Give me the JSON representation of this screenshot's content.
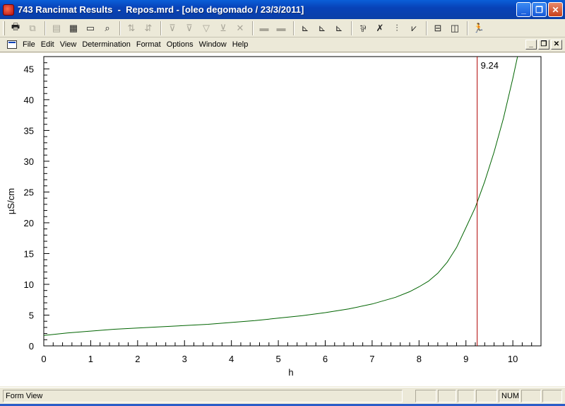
{
  "window": {
    "title": "743 Rancimat Results  -  Repos.mrd - [oleo degomado / 23/3/2011]",
    "controls": [
      "_",
      "❐",
      "✕"
    ]
  },
  "toolbar": {
    "groups": [
      [
        {
          "icon": "printer-icon",
          "glyph": "🖶",
          "enabled": true
        },
        {
          "icon": "copy-icon",
          "glyph": "⧉",
          "enabled": false
        }
      ],
      [
        {
          "icon": "form-view-icon",
          "glyph": "▤",
          "enabled": false
        },
        {
          "icon": "table-view-icon",
          "glyph": "▦",
          "enabled": true
        },
        {
          "icon": "card-view-icon",
          "glyph": "▭",
          "enabled": true
        },
        {
          "icon": "binoculars-icon",
          "glyph": "⌕",
          "enabled": true
        }
      ],
      [
        {
          "icon": "sort-ascending-icon",
          "glyph": "⇅",
          "enabled": false
        },
        {
          "icon": "sort-descending-icon",
          "glyph": "⇵",
          "enabled": false
        }
      ],
      [
        {
          "icon": "filter-icon",
          "glyph": "⊽",
          "enabled": false
        },
        {
          "icon": "filter-add-icon",
          "glyph": "⊽",
          "enabled": false
        },
        {
          "icon": "filter-clear-icon",
          "glyph": "▽",
          "enabled": false
        },
        {
          "icon": "filter-remove-icon",
          "glyph": "⊻",
          "enabled": false
        },
        {
          "icon": "delete-icon",
          "glyph": "✕",
          "enabled": false
        }
      ],
      [
        {
          "icon": "record-prev-icon",
          "glyph": "▬",
          "enabled": false
        },
        {
          "icon": "record-next-icon",
          "glyph": "▬",
          "enabled": false
        }
      ],
      [
        {
          "icon": "curve-red-icon",
          "glyph": "⊾",
          "enabled": true
        },
        {
          "icon": "curve-blue-icon",
          "glyph": "⊾",
          "enabled": true
        },
        {
          "icon": "curve-multi-icon",
          "glyph": "⊾",
          "enabled": true
        }
      ],
      [
        {
          "icon": "evaluate-icon",
          "glyph": "⅌",
          "enabled": true
        },
        {
          "icon": "cross-evaluate-icon",
          "glyph": "✗",
          "enabled": true
        },
        {
          "icon": "column-icon",
          "glyph": "⫶",
          "enabled": true
        },
        {
          "icon": "marker-icon",
          "glyph": "⩗",
          "enabled": true
        }
      ],
      [
        {
          "icon": "split-horizontal-icon",
          "glyph": "⊟",
          "enabled": true
        },
        {
          "icon": "split-vertical-icon",
          "glyph": "◫",
          "enabled": true
        }
      ],
      [
        {
          "icon": "runner-icon",
          "glyph": "🏃",
          "enabled": true
        }
      ]
    ]
  },
  "menu": {
    "items": [
      {
        "label": "File"
      },
      {
        "label": "Edit"
      },
      {
        "label": "View"
      },
      {
        "label": "Determination"
      },
      {
        "label": "Format"
      },
      {
        "label": "Options"
      },
      {
        "label": "Window"
      },
      {
        "label": "Help"
      }
    ],
    "mdi_controls": [
      "_",
      "❐",
      "✕"
    ]
  },
  "chart_data": {
    "type": "line",
    "xlabel": "h",
    "ylabel": "µS/cm",
    "xlim": [
      0,
      10.6
    ],
    "ylim": [
      0,
      47
    ],
    "xticks": [
      0,
      1,
      2,
      3,
      4,
      5,
      6,
      7,
      8,
      9,
      10
    ],
    "yticks": [
      0,
      5,
      10,
      15,
      20,
      25,
      30,
      35,
      40,
      45
    ],
    "series": [
      {
        "color": "#006400",
        "x": [
          0,
          0.5,
          1,
          1.5,
          2,
          2.5,
          3,
          3.5,
          4,
          4.5,
          5,
          5.5,
          6,
          6.5,
          7,
          7.5,
          7.8,
          8,
          8.2,
          8.4,
          8.6,
          8.8,
          9,
          9.2,
          9.4,
          9.6,
          9.8,
          10,
          10.1
        ],
        "y": [
          1.7,
          2.1,
          2.4,
          2.7,
          2.9,
          3.1,
          3.3,
          3.5,
          3.8,
          4.1,
          4.5,
          4.9,
          5.4,
          6.0,
          6.8,
          7.9,
          8.8,
          9.6,
          10.5,
          11.8,
          13.6,
          16.0,
          19.2,
          22.5,
          26.7,
          31.5,
          37.0,
          43.5,
          47
        ]
      }
    ],
    "marker_line": {
      "x": 9.24,
      "label": "9.24",
      "color": "#b00000"
    }
  },
  "status": {
    "left_text": "Form View",
    "num_indicator": "NUM"
  }
}
